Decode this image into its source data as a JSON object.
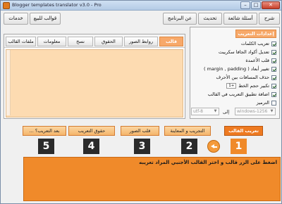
{
  "window": {
    "title": "Blogger templates translator v3.0 - Pro",
    "close_glyph": "✕",
    "min_glyph": "–",
    "max_glyph": "□"
  },
  "menu": {
    "items": [
      "شرح",
      "أسئلة شائعة",
      "تحديث",
      "عن البرنامج",
      "قوالب للبيع",
      "خدمات"
    ]
  },
  "left_tabs": {
    "items": [
      "قالب",
      "روابط الصور",
      "الحقوق",
      "نسخ",
      "معلومات",
      "ملفات القالب"
    ],
    "active_index": 0
  },
  "editor": {
    "value": ""
  },
  "options": {
    "header": "إعدادات التعريب",
    "items": [
      {
        "label": "تعريب الكلمات",
        "checked": true
      },
      {
        "label": "تعديل أكواد الجافا سكريبت",
        "checked": true
      },
      {
        "label": "قلب الأعمدة",
        "checked": true
      },
      {
        "label": "تغيير أبعاد ( margin , padding )",
        "checked": true
      },
      {
        "label": "حذف المسافات بين الأحرف",
        "checked": true
      },
      {
        "label": "تكبير حجم الخط",
        "checked": true,
        "value": "1+"
      },
      {
        "label": "اضافة تطبيق التعريب في القالب",
        "checked": true
      },
      {
        "label": "الترميز",
        "checked": false
      }
    ],
    "encoding": {
      "from": "windows-1256",
      "separator": "إلى",
      "to": "utf-8"
    }
  },
  "steps": {
    "items": [
      {
        "label": "تعريب القالب",
        "number": "1"
      },
      {
        "label": "التجريب و المعاينة",
        "number": "2"
      },
      {
        "label": "قلب الصور",
        "number": "3"
      },
      {
        "label": "حقوق التعريب",
        "number": "4"
      },
      {
        "label": "... بعد التعريب؟",
        "number": "5"
      }
    ],
    "active_index": 0
  },
  "instruction": {
    "text": "اضغط على الزر قالب و اختر القالب الأجنبي المراد تعريبه"
  },
  "colors": {
    "accent_orange": "#f08a2a",
    "editor_bg": "#fddbb1",
    "dark_badge": "#2b2b2b"
  }
}
